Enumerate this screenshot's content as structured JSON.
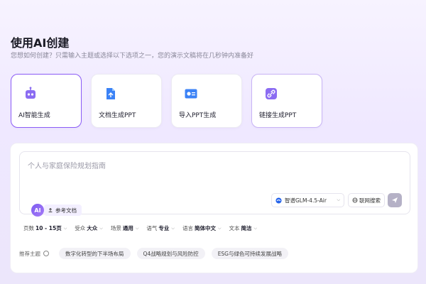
{
  "header": {
    "title": "使用AI创建",
    "subtitle": "您想如何创建？只需输入主题或选择以下选项之一，您的演示文稿将在几秒钟内准备好"
  },
  "cards": [
    {
      "label": "AI智能生成",
      "icon": "robot-icon",
      "selected": true
    },
    {
      "label": "文档生成PPT",
      "icon": "document-icon",
      "selected": false
    },
    {
      "label": "导入PPT生成",
      "icon": "slide-import-icon",
      "selected": false
    },
    {
      "label": "链接生成PPT",
      "icon": "link-icon",
      "selected": false
    }
  ],
  "prompt": {
    "placeholder": "个人与家庭保险规划指南"
  },
  "toolbar": {
    "ai_badge": "AI",
    "reference_doc": "参考文档",
    "model": "智谱GLM-4.5-Air",
    "web_search": "联网搜索"
  },
  "options": [
    {
      "label": "页数",
      "value": "10 - 15页"
    },
    {
      "label": "受众",
      "value": "大众"
    },
    {
      "label": "场景",
      "value": "通用"
    },
    {
      "label": "语气",
      "value": "专业"
    },
    {
      "label": "语言",
      "value": "简体中文"
    },
    {
      "label": "文本",
      "value": "简洁"
    }
  ],
  "recommend": {
    "label": "推荐主题",
    "topics": [
      "数字化转型的下半场布局",
      "Q4战略规划与风险防控",
      "ESG与绿色可持续发展战略"
    ]
  },
  "colors": {
    "accent": "#8b5cf6",
    "card_selected_border": "#8b5cf6",
    "send_disabled": "#b5b1c6"
  }
}
